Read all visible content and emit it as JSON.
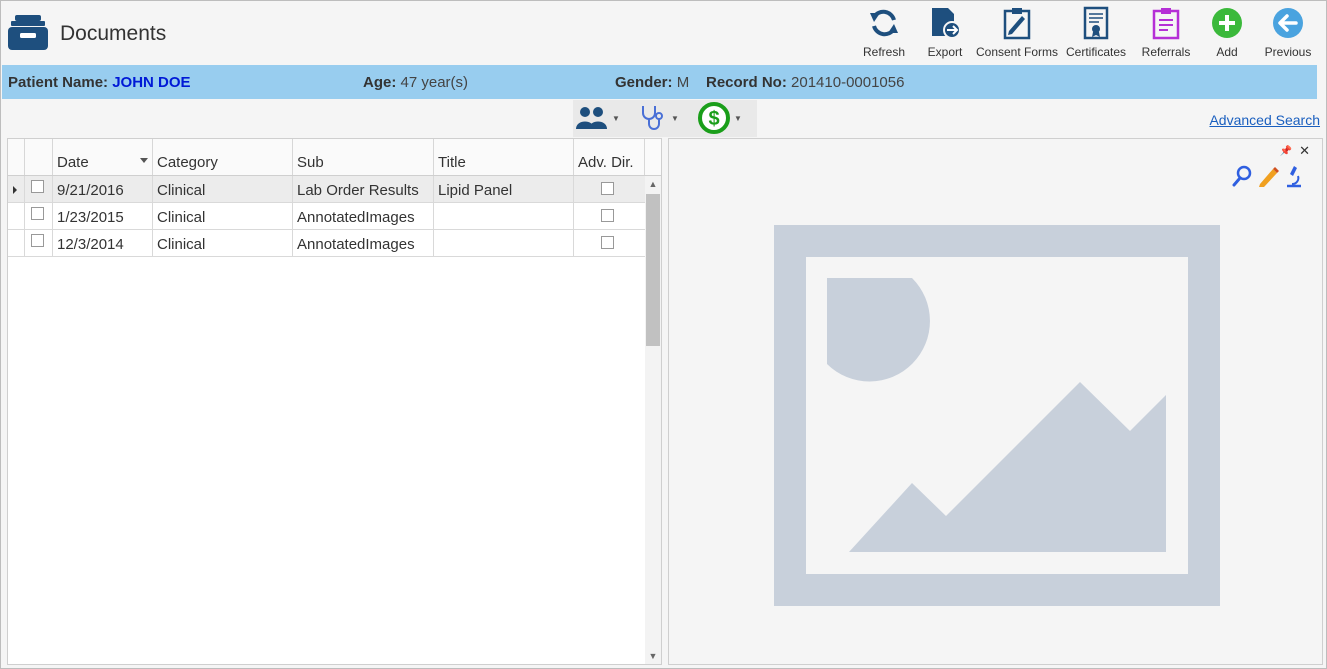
{
  "app": {
    "title": "Documents",
    "icon": "cabinet-icon"
  },
  "toolbar": {
    "refresh": {
      "label": "Refresh",
      "icon": "refresh-icon"
    },
    "export": {
      "label": "Export",
      "icon": "export-icon"
    },
    "consent_forms": {
      "label": "Consent Forms",
      "icon": "clipboard-pen-icon"
    },
    "certificates": {
      "label": "Certificates",
      "icon": "certificate-icon"
    },
    "referrals": {
      "label": "Referrals",
      "icon": "referral-clipboard-icon"
    },
    "add": {
      "label": "Add",
      "icon": "plus-circle-icon"
    },
    "previous": {
      "label": "Previous",
      "icon": "arrow-left-circle-icon"
    }
  },
  "patient": {
    "name_label": "Patient Name:",
    "name": "JOHN DOE",
    "age_label": "Age:",
    "age": "47 year(s)",
    "gender_label": "Gender:",
    "gender": "M",
    "record_label": "Record No:",
    "record": "201410-0001056"
  },
  "filters": [
    {
      "icon": "people-icon"
    },
    {
      "icon": "stethoscope-icon"
    },
    {
      "icon": "dollar-circle-icon"
    }
  ],
  "advanced_search": "Advanced Search",
  "grid": {
    "columns": {
      "date": "Date",
      "category": "Category",
      "sub": "Sub",
      "title": "Title",
      "adv_dir": "Adv. Dir."
    },
    "rows": [
      {
        "date": "9/21/2016",
        "category": "Clinical",
        "sub": "Lab Order Results",
        "title": "Lipid Panel"
      },
      {
        "date": "1/23/2015",
        "category": "Clinical",
        "sub": "AnnotatedImages",
        "title": ""
      },
      {
        "date": "12/3/2014",
        "category": "Clinical",
        "sub": "AnnotatedImages",
        "title": ""
      }
    ]
  },
  "preview": {
    "tools": [
      "search-icon",
      "pencil-icon",
      "microscope-icon"
    ],
    "placeholder_icon": "image-placeholder-icon",
    "colors": {
      "placeholder": "#c8d0db"
    }
  },
  "colors": {
    "patient_bar": "#98cdef",
    "patient_name": "#0019d6",
    "brand": "#1e4f7e"
  }
}
